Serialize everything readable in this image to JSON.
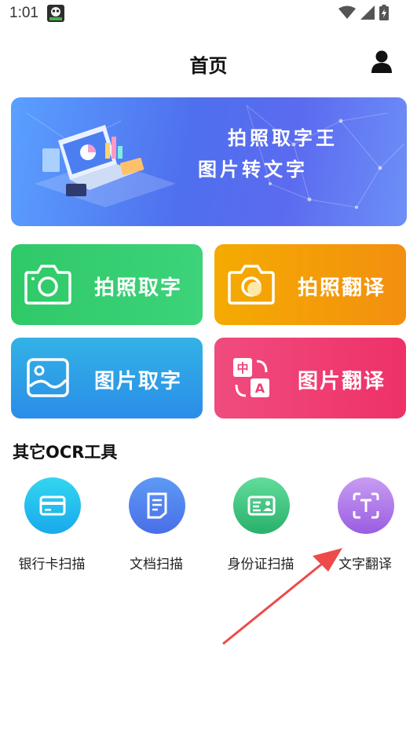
{
  "status_bar": {
    "time": "1:01",
    "icons": [
      "app-notification-icon",
      "wifi-icon",
      "signal-icon",
      "battery-charging-icon"
    ]
  },
  "header": {
    "title": "首页",
    "profile_icon": "person-icon"
  },
  "banner": {
    "line1": "拍照取字王",
    "line2": "图片转文字"
  },
  "features": [
    {
      "label": "拍照取字",
      "icon": "camera-icon",
      "color": "#33cc6c"
    },
    {
      "label": "拍照翻译",
      "icon": "camera-translate-icon",
      "color": "#f3a005"
    },
    {
      "label": "图片取字",
      "icon": "image-icon",
      "color": "#2f9fe7"
    },
    {
      "label": "图片翻译",
      "icon": "translate-icon",
      "color": "#ef3f73"
    }
  ],
  "tools_section": {
    "title": "其它OCR工具",
    "items": [
      {
        "label": "银行卡扫描",
        "icon": "bank-card-icon"
      },
      {
        "label": "文档扫描",
        "icon": "document-icon"
      },
      {
        "label": "身份证扫描",
        "icon": "id-card-icon"
      },
      {
        "label": "文字翻译",
        "icon": "text-scan-icon"
      }
    ]
  },
  "annotation": {
    "color": "#ee4a4a",
    "icon": "red-arrow-icon"
  }
}
